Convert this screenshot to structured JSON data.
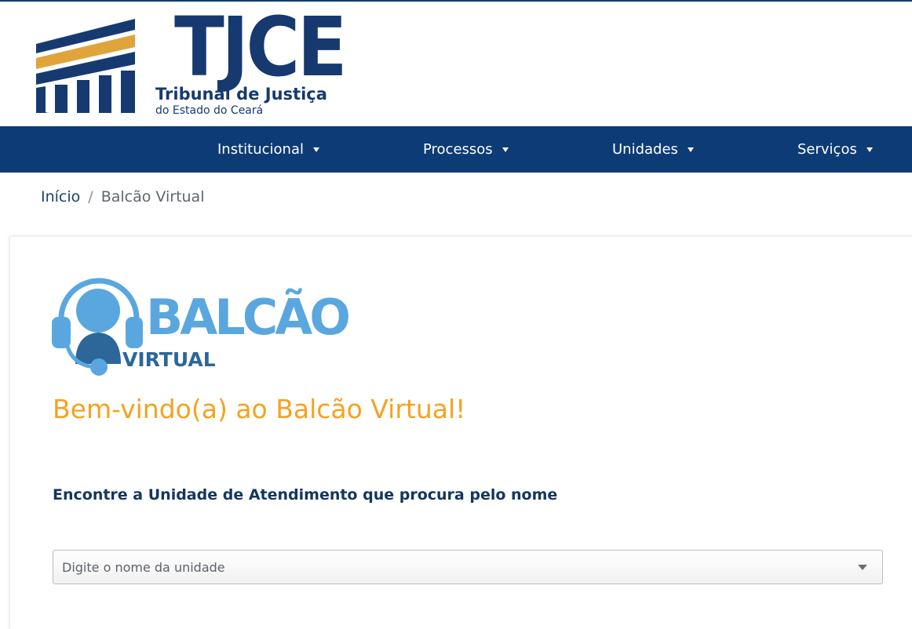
{
  "header": {
    "logo_title": "TJCE",
    "logo_subtitle": "Tribunal de Justiça",
    "logo_subtitle2": "do Estado do Ceará",
    "brand_color": "#163a70",
    "accent_color": "#e0a43a"
  },
  "nav": {
    "background": "#0d3b75",
    "items": [
      {
        "label": "Institucional",
        "icon": "caret-down-icon"
      },
      {
        "label": "Processos",
        "icon": "caret-down-icon"
      },
      {
        "label": "Unidades",
        "icon": "caret-down-icon"
      },
      {
        "label": "Serviços",
        "icon": "caret-down-icon"
      }
    ]
  },
  "breadcrumb": {
    "home": "Início",
    "separator": "/",
    "current": "Balcão Virtual"
  },
  "main": {
    "logo_word": "BALCÃO",
    "logo_word2": "VIRTUAL",
    "logo_icon": "headset-icon",
    "welcome": "Bem-vindo(a) ao Balcão Virtual!",
    "welcome_color": "#f5a21f",
    "find_label": "Encontre a Unidade de Atendimento que procura pelo nome",
    "select": {
      "placeholder": "Digite o nome da unidade",
      "icon": "chevron-down-icon"
    }
  }
}
